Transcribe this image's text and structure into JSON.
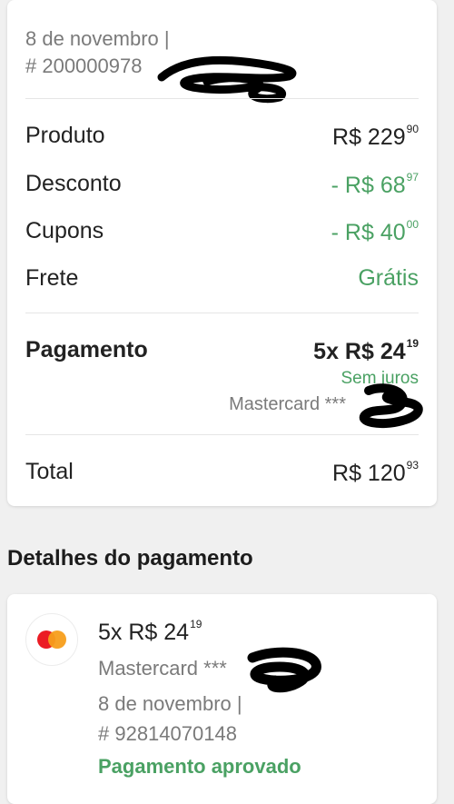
{
  "order": {
    "date": "8 de novembro  |",
    "number": "# 200000978"
  },
  "summary": {
    "product_label": "Produto",
    "product_value": "R$ 229",
    "product_cents": "90",
    "discount_label": "Desconto",
    "discount_value": "- R$ 68",
    "discount_cents": "97",
    "coupons_label": "Cupons",
    "coupons_value": "- R$ 40",
    "coupons_cents": "00",
    "shipping_label": "Frete",
    "shipping_value": "Grátis",
    "payment_label": "Pagamento",
    "payment_value": "5x R$ 24",
    "payment_cents": "19",
    "interest_text": "Sem juros",
    "card_text": "Mastercard ***",
    "total_label": "Total",
    "total_value": "R$ 120",
    "total_cents": "93"
  },
  "details": {
    "section_title": "Detalhes do pagamento",
    "amount": "5x R$ 24",
    "amount_cents": "19",
    "card_text": "Mastercard ***",
    "date": "8 de novembro  |",
    "transaction": "# 92814070148",
    "status": "Pagamento aprovado"
  },
  "icons": {
    "card_brand": "mastercard-icon"
  },
  "colors": {
    "green": "#4aa163",
    "mastercard_red": "#eb1c24",
    "mastercard_orange": "#f79e1b"
  }
}
